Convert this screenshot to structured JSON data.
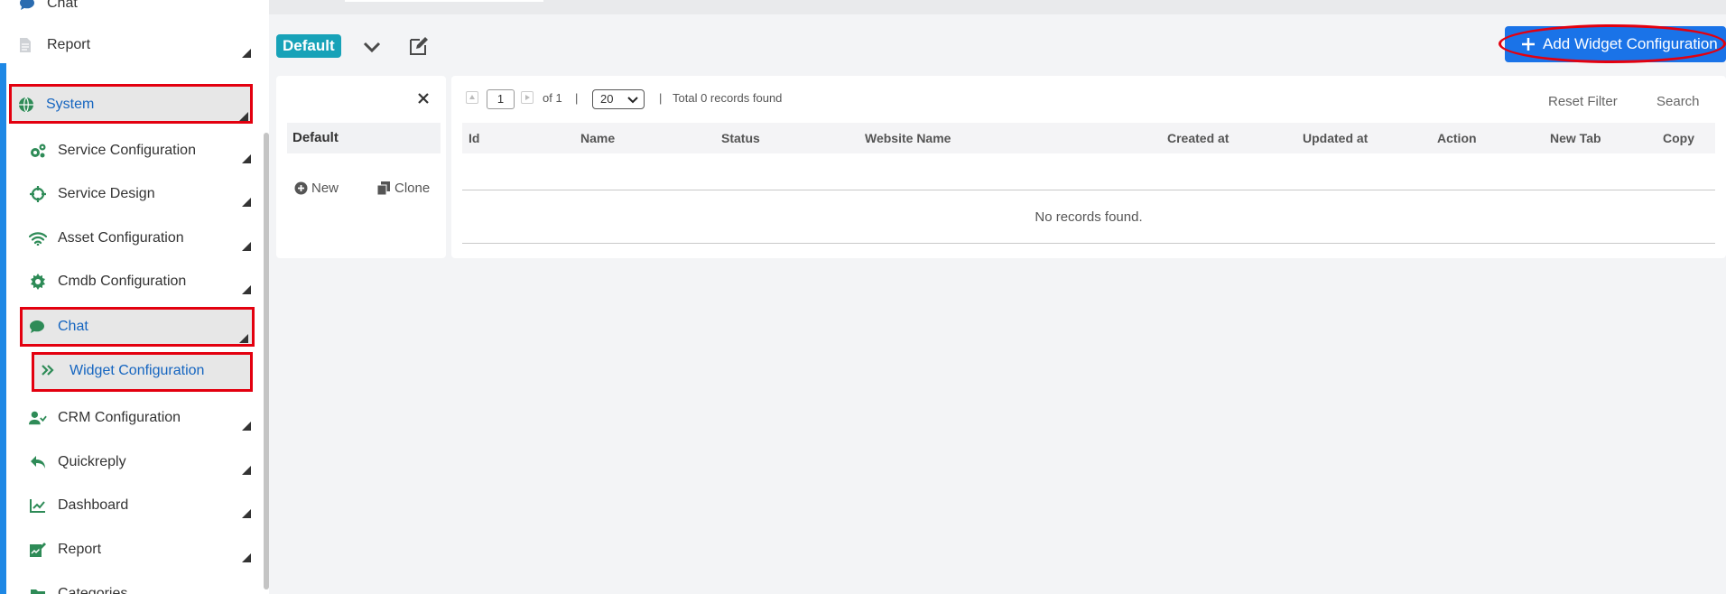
{
  "sidebar": {
    "items": [
      {
        "label": "Chat",
        "icon": "chat-bubble-icon"
      },
      {
        "label": "Report",
        "icon": "document-icon"
      },
      {
        "label": "System",
        "icon": "globe-icon",
        "active": true
      },
      {
        "label": "Service Configuration",
        "icon": "gears-icon"
      },
      {
        "label": "Service Design",
        "icon": "crosshair-icon"
      },
      {
        "label": "Asset Configuration",
        "icon": "wifi-icon"
      },
      {
        "label": "Cmdb Configuration",
        "icon": "gear-icon"
      },
      {
        "label": "Chat",
        "icon": "chat-bubble-icon",
        "active": true
      },
      {
        "label": "Widget Configuration",
        "icon": "double-chevron-right-icon",
        "active": true
      },
      {
        "label": "CRM Configuration",
        "icon": "user-check-icon"
      },
      {
        "label": "Quickreply",
        "icon": "reply-icon"
      },
      {
        "label": "Dashboard",
        "icon": "line-chart-icon"
      },
      {
        "label": "Report",
        "icon": "report-edit-icon"
      },
      {
        "label": "Categories",
        "icon": "folder-icon"
      }
    ]
  },
  "toolbar": {
    "profile_badge": "Default",
    "add_button_label": "Add Widget Configuration"
  },
  "left_panel": {
    "selected_item": "Default",
    "new_label": "New",
    "clone_label": "Clone"
  },
  "pagination": {
    "current_page": "1",
    "of_text": "of 1",
    "separator": "|",
    "page_size": "20",
    "total_text": "Total 0 records found"
  },
  "filters": {
    "reset_label": "Reset Filter",
    "search_label": "Search"
  },
  "table": {
    "columns": [
      "Id",
      "Name",
      "Status",
      "Website Name",
      "Created at",
      "Updated at",
      "Action",
      "New Tab",
      "Copy"
    ],
    "rows": [],
    "empty_text": "No records found."
  },
  "colors": {
    "accent_blue": "#1a73e8",
    "badge_teal": "#17a2b8",
    "icon_green": "#2e8b57",
    "highlight_red": "#e3000f",
    "sidebar_accent": "#1e88e5"
  }
}
